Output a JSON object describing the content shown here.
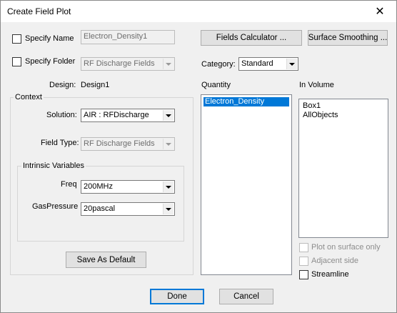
{
  "window": {
    "title": "Create Field Plot"
  },
  "name_row": {
    "checkbox_label": "Specify Name",
    "name_value": "Electron_Density1"
  },
  "folder_row": {
    "checkbox_label": "Specify Folder",
    "folder_value": "RF Discharge Fields"
  },
  "design": {
    "label": "Design:",
    "value": "Design1"
  },
  "context": {
    "title": "Context",
    "solution_label": "Solution:",
    "solution_value": "AIR : RFDischarge",
    "field_type_label": "Field Type:",
    "field_type_value": "RF Discharge Fields"
  },
  "intrinsic": {
    "title": "Intrinsic Variables",
    "freq_label": "Freq",
    "freq_value": "200MHz",
    "gas_label": "GasPressure",
    "gas_value": "20pascal"
  },
  "buttons": {
    "save_default": "Save As Default",
    "fields_calculator": "Fields Calculator ...",
    "surface_smoothing": "Surface Smoothing ...",
    "done": "Done",
    "cancel": "Cancel"
  },
  "category": {
    "label": "Category:",
    "value": "Standard"
  },
  "quantity": {
    "label": "Quantity",
    "items": [
      "Electron_Density"
    ]
  },
  "in_volume": {
    "label": "In Volume",
    "items": [
      "Box1",
      "AllObjects"
    ]
  },
  "options": {
    "plot_on_surface": "Plot on surface only",
    "adjacent_side": "Adjacent side",
    "streamline": "Streamline"
  },
  "icons": {
    "close": "close-icon",
    "dropdown": "chevron-down-icon"
  }
}
